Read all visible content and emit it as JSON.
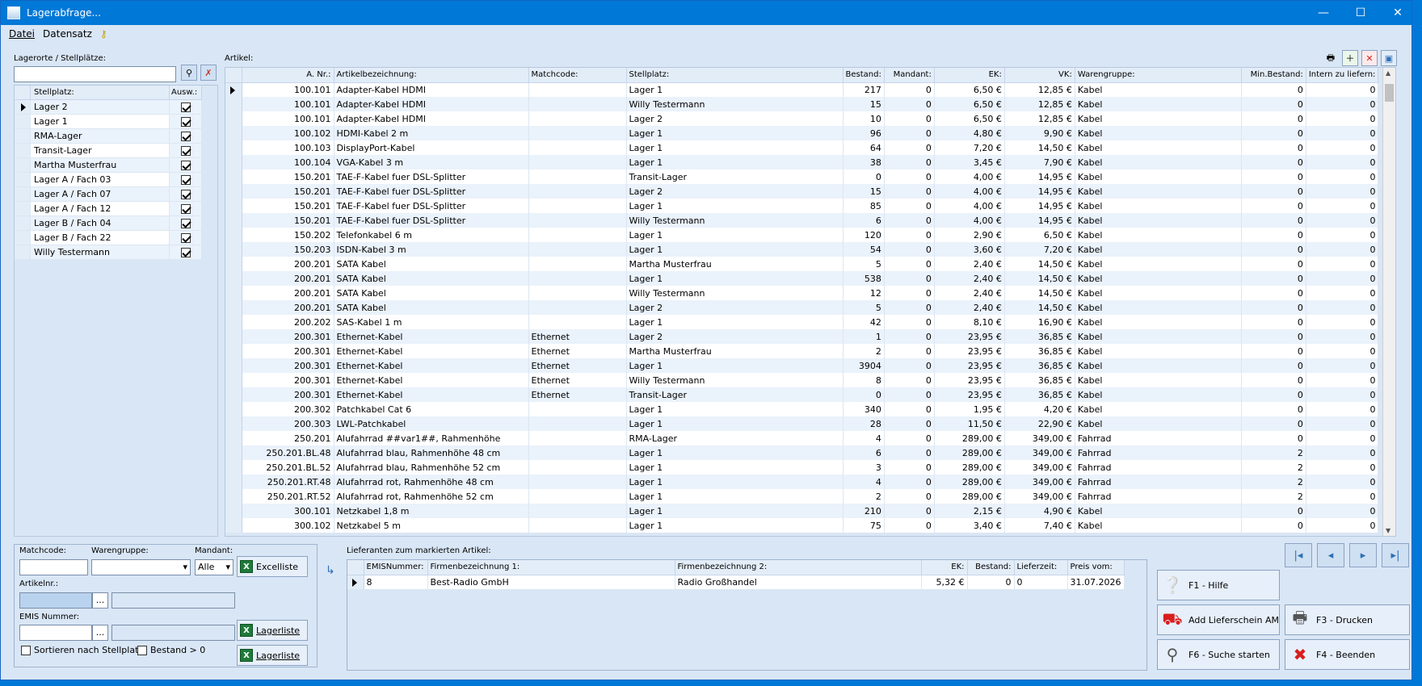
{
  "window": {
    "title": "Lagerabfrage...",
    "controls": {
      "minimize": "—",
      "maximize": "☐",
      "close": "✕"
    }
  },
  "menu": {
    "datei": "Datei",
    "datensatz": "Datensatz",
    "help_icon": "key-help-icon"
  },
  "left": {
    "label": "Lagerorte / Stellplätze:",
    "filter_value": "",
    "columns": {
      "stellplatz": "Stellplatz:",
      "ausw": "Ausw.:"
    },
    "rows": [
      {
        "name": "Lager 2",
        "checked": true,
        "current": true
      },
      {
        "name": "Lager 1",
        "checked": true
      },
      {
        "name": "RMA-Lager",
        "checked": true
      },
      {
        "name": "Transit-Lager",
        "checked": true
      },
      {
        "name": "Martha Musterfrau",
        "checked": true
      },
      {
        "name": "Lager A / Fach 03",
        "checked": true
      },
      {
        "name": "Lager A / Fach 07",
        "checked": true
      },
      {
        "name": "Lager A / Fach 12",
        "checked": true
      },
      {
        "name": "Lager B / Fach 04",
        "checked": true
      },
      {
        "name": "Lager B / Fach 22",
        "checked": true
      },
      {
        "name": "Willy Testermann",
        "checked": true
      }
    ]
  },
  "articles": {
    "label": "Artikel:",
    "columns": [
      "A. Nr.:",
      "Artikelbezeichnung:",
      "Matchcode:",
      "Stellplatz:",
      "Bestand:",
      "Mandant:",
      "EK:",
      "VK:",
      "Warengruppe:",
      "Min.Bestand:",
      "Intern zu liefern:"
    ],
    "rows": [
      [
        "100.101",
        "Adapter-Kabel HDMI",
        "",
        "Lager 1",
        "217",
        "0",
        "6,50 €",
        "12,85 €",
        "Kabel",
        "0",
        "0"
      ],
      [
        "100.101",
        "Adapter-Kabel HDMI",
        "",
        "Willy Testermann",
        "15",
        "0",
        "6,50 €",
        "12,85 €",
        "Kabel",
        "0",
        "0"
      ],
      [
        "100.101",
        "Adapter-Kabel HDMI",
        "",
        "Lager 2",
        "10",
        "0",
        "6,50 €",
        "12,85 €",
        "Kabel",
        "0",
        "0"
      ],
      [
        "100.102",
        "HDMI-Kabel 2 m",
        "",
        "Lager 1",
        "96",
        "0",
        "4,80 €",
        "9,90 €",
        "Kabel",
        "0",
        "0"
      ],
      [
        "100.103",
        "DisplayPort-Kabel",
        "",
        "Lager 1",
        "64",
        "0",
        "7,20 €",
        "14,50 €",
        "Kabel",
        "0",
        "0"
      ],
      [
        "100.104",
        "VGA-Kabel 3 m",
        "",
        "Lager 1",
        "38",
        "0",
        "3,45 €",
        "7,90 €",
        "Kabel",
        "0",
        "0"
      ],
      [
        "150.201",
        "TAE-F-Kabel fuer DSL-Splitter",
        "",
        "Transit-Lager",
        "0",
        "0",
        "4,00 €",
        "14,95 €",
        "Kabel",
        "0",
        "0"
      ],
      [
        "150.201",
        "TAE-F-Kabel fuer DSL-Splitter",
        "",
        "Lager 2",
        "15",
        "0",
        "4,00 €",
        "14,95 €",
        "Kabel",
        "0",
        "0"
      ],
      [
        "150.201",
        "TAE-F-Kabel fuer DSL-Splitter",
        "",
        "Lager 1",
        "85",
        "0",
        "4,00 €",
        "14,95 €",
        "Kabel",
        "0",
        "0"
      ],
      [
        "150.201",
        "TAE-F-Kabel fuer DSL-Splitter",
        "",
        "Willy Testermann",
        "6",
        "0",
        "4,00 €",
        "14,95 €",
        "Kabel",
        "0",
        "0"
      ],
      [
        "150.202",
        "Telefonkabel 6 m",
        "",
        "Lager 1",
        "120",
        "0",
        "2,90 €",
        "6,50 €",
        "Kabel",
        "0",
        "0"
      ],
      [
        "150.203",
        "ISDN-Kabel 3 m",
        "",
        "Lager 1",
        "54",
        "0",
        "3,60 €",
        "7,20 €",
        "Kabel",
        "0",
        "0"
      ],
      [
        "200.201",
        "SATA Kabel",
        "",
        "Martha Musterfrau",
        "5",
        "0",
        "2,40 €",
        "14,50 €",
        "Kabel",
        "0",
        "0"
      ],
      [
        "200.201",
        "SATA Kabel",
        "",
        "Lager 1",
        "538",
        "0",
        "2,40 €",
        "14,50 €",
        "Kabel",
        "0",
        "0"
      ],
      [
        "200.201",
        "SATA Kabel",
        "",
        "Willy Testermann",
        "12",
        "0",
        "2,40 €",
        "14,50 €",
        "Kabel",
        "0",
        "0"
      ],
      [
        "200.201",
        "SATA Kabel",
        "",
        "Lager 2",
        "5",
        "0",
        "2,40 €",
        "14,50 €",
        "Kabel",
        "0",
        "0"
      ],
      [
        "200.202",
        "SAS-Kabel 1 m",
        "",
        "Lager 1",
        "42",
        "0",
        "8,10 €",
        "16,90 €",
        "Kabel",
        "0",
        "0"
      ],
      [
        "200.301",
        "Ethernet-Kabel",
        "Ethernet",
        "Lager 2",
        "1",
        "0",
        "23,95 €",
        "36,85 €",
        "Kabel",
        "0",
        "0"
      ],
      [
        "200.301",
        "Ethernet-Kabel",
        "Ethernet",
        "Martha Musterfrau",
        "2",
        "0",
        "23,95 €",
        "36,85 €",
        "Kabel",
        "0",
        "0"
      ],
      [
        "200.301",
        "Ethernet-Kabel",
        "Ethernet",
        "Lager 1",
        "3904",
        "0",
        "23,95 €",
        "36,85 €",
        "Kabel",
        "0",
        "0"
      ],
      [
        "200.301",
        "Ethernet-Kabel",
        "Ethernet",
        "Willy Testermann",
        "8",
        "0",
        "23,95 €",
        "36,85 €",
        "Kabel",
        "0",
        "0"
      ],
      [
        "200.301",
        "Ethernet-Kabel",
        "Ethernet",
        "Transit-Lager",
        "0",
        "0",
        "23,95 €",
        "36,85 €",
        "Kabel",
        "0",
        "0"
      ],
      [
        "200.302",
        "Patchkabel Cat 6",
        "",
        "Lager 1",
        "340",
        "0",
        "1,95 €",
        "4,20 €",
        "Kabel",
        "0",
        "0"
      ],
      [
        "200.303",
        "LWL-Patchkabel",
        "",
        "Lager 1",
        "28",
        "0",
        "11,50 €",
        "22,90 €",
        "Kabel",
        "0",
        "0"
      ],
      [
        "250.201",
        "Alufahrrad ##var1##, Rahmenhöhe",
        "",
        "RMA-Lager",
        "4",
        "0",
        "289,00 €",
        "349,00 €",
        "Fahrrad",
        "0",
        "0"
      ],
      [
        "250.201.BL.48",
        "Alufahrrad blau, Rahmenhöhe 48 cm",
        "",
        "Lager 1",
        "6",
        "0",
        "289,00 €",
        "349,00 €",
        "Fahrrad",
        "2",
        "0"
      ],
      [
        "250.201.BL.52",
        "Alufahrrad blau, Rahmenhöhe 52 cm",
        "",
        "Lager 1",
        "3",
        "0",
        "289,00 €",
        "349,00 €",
        "Fahrrad",
        "2",
        "0"
      ],
      [
        "250.201.RT.48",
        "Alufahrrad rot, Rahmenhöhe 48 cm",
        "",
        "Lager 1",
        "4",
        "0",
        "289,00 €",
        "349,00 €",
        "Fahrrad",
        "2",
        "0"
      ],
      [
        "250.201.RT.52",
        "Alufahrrad rot, Rahmenhöhe 52 cm",
        "",
        "Lager 1",
        "2",
        "0",
        "289,00 €",
        "349,00 €",
        "Fahrrad",
        "2",
        "0"
      ],
      [
        "300.101",
        "Netzkabel 1,8 m",
        "",
        "Lager 1",
        "210",
        "0",
        "2,15 €",
        "4,90 €",
        "Kabel",
        "0",
        "0"
      ],
      [
        "300.102",
        "Netzkabel 5 m",
        "",
        "Lager 1",
        "75",
        "0",
        "3,40 €",
        "7,40 €",
        "Kabel",
        "0",
        "0"
      ]
    ]
  },
  "filters": {
    "matchcode_label": "Matchcode:",
    "warengruppe_label": "Warengruppe:",
    "mandant_label": "Mandant:",
    "mandant_value": "Alle",
    "artikelnr_label": "Artikelnr.:",
    "emis_label": "EMIS Nummer:",
    "ellipsis": "...",
    "sort_label": "Sortieren nach Stellplatz",
    "bestand_label": "Bestand > 0",
    "excelliste": "Excelliste",
    "lagerliste1": "Lagerliste",
    "lagerliste2": "Lagerliste"
  },
  "suppliers": {
    "label": "Lieferanten zum markierten Artikel:",
    "columns": [
      "EMISNummer:",
      "Firmenbezeichnung 1:",
      "Firmenbezeichnung 2:",
      "EK:",
      "Bestand:",
      "Lieferzeit:",
      "Preis vom:"
    ],
    "rows": [
      [
        "8",
        "Best-Radio GmbH",
        "Radio Großhandel",
        "5,32 €",
        "0",
        "0",
        "31.07.2026"
      ]
    ]
  },
  "nav": {
    "first": "|◂",
    "prev": "◂",
    "next": "▸",
    "last": "▸|"
  },
  "actions": {
    "hilfe": "F1 - Hilfe",
    "lieferschein": "Add Lieferschein AM",
    "drucken": "F3 - Drucken",
    "suche": "F6 - Suche starten",
    "beenden": "F4 - Beenden"
  },
  "colors": {
    "titlebar": "#0078d7",
    "panel": "#d9e6f5",
    "accent": "#2e6fb5",
    "close_red": "#d81e1e"
  }
}
